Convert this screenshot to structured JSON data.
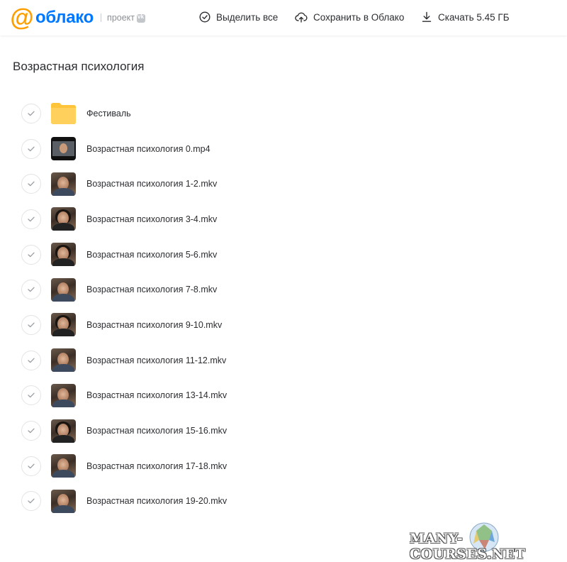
{
  "header": {
    "logo_symbol": "@",
    "logo_text": "облако",
    "logo_sub": "проект",
    "actions": {
      "select_all": "Выделить все",
      "save_to_cloud": "Сохранить в Облако",
      "download": "Скачать 5.45 ГБ"
    }
  },
  "colors": {
    "brand_blue": "#0077ff",
    "brand_orange": "#ff9e00",
    "folder_yellow": "#ffc43a",
    "text_dark": "#2b2d31"
  },
  "page_title": "Возрастная психология",
  "items": [
    {
      "name": "Фестиваль",
      "type": "folder",
      "icon": "folder-icon"
    },
    {
      "name": "Возрастная психология 0.mp4",
      "type": "video",
      "icon": "video-thumbnail"
    },
    {
      "name": "Возрастная психология 1-2.mkv",
      "type": "video",
      "icon": "video-thumbnail"
    },
    {
      "name": "Возрастная психология 3-4.mkv",
      "type": "video",
      "icon": "video-thumbnail"
    },
    {
      "name": "Возрастная психология 5-6.mkv",
      "type": "video",
      "icon": "video-thumbnail"
    },
    {
      "name": "Возрастная психология 7-8.mkv",
      "type": "video",
      "icon": "video-thumbnail"
    },
    {
      "name": "Возрастная психология 9-10.mkv",
      "type": "video",
      "icon": "video-thumbnail"
    },
    {
      "name": "Возрастная психология 11-12.mkv",
      "type": "video",
      "icon": "video-thumbnail"
    },
    {
      "name": "Возрастная психология 13-14.mkv",
      "type": "video",
      "icon": "video-thumbnail"
    },
    {
      "name": "Возрастная психология 15-16.mkv",
      "type": "video",
      "icon": "video-thumbnail"
    },
    {
      "name": "Возрастная психология 17-18.mkv",
      "type": "video",
      "icon": "video-thumbnail"
    },
    {
      "name": "Возрастная психология 19-20.mkv",
      "type": "video",
      "icon": "video-thumbnail"
    }
  ],
  "watermark": "MANY-COURSES.NET"
}
